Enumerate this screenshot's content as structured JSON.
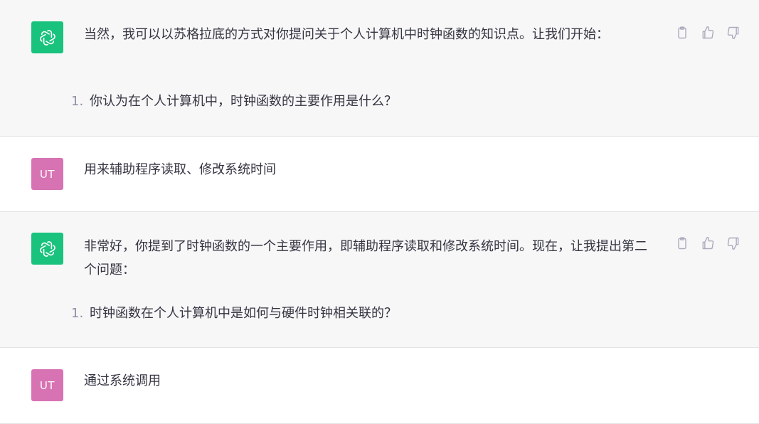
{
  "messages": [
    {
      "role": "assistant",
      "text": "当然，我可以以苏格拉底的方式对你提问关于个人计算机中时钟函数的知识点。让我们开始：",
      "list": [
        {
          "num": "1.",
          "text": "你认为在个人计算机中，时钟函数的主要作用是什么？"
        }
      ]
    },
    {
      "role": "user",
      "avatar_initials": "UT",
      "text": "用来辅助程序读取、修改系统时间"
    },
    {
      "role": "assistant",
      "text": "非常好，你提到了时钟函数的一个主要作用，即辅助程序读取和修改系统时间。现在，让我提出第二个问题：",
      "list": [
        {
          "num": "1.",
          "text": "时钟函数在个人计算机中是如何与硬件时钟相关联的？"
        }
      ]
    },
    {
      "role": "user",
      "avatar_initials": "UT",
      "text": "通过系统调用"
    }
  ],
  "icons": {
    "assistant_avatar": "openai-logo-icon",
    "copy": "clipboard-icon",
    "like": "thumbs-up-icon",
    "dislike": "thumbs-down-icon"
  },
  "colors": {
    "assistant_bg": "#f7f7f8",
    "assistant_avatar_bg": "#19c37d",
    "user_avatar_bg": "#d772b3",
    "text": "#343541",
    "icon": "#acacbe"
  }
}
